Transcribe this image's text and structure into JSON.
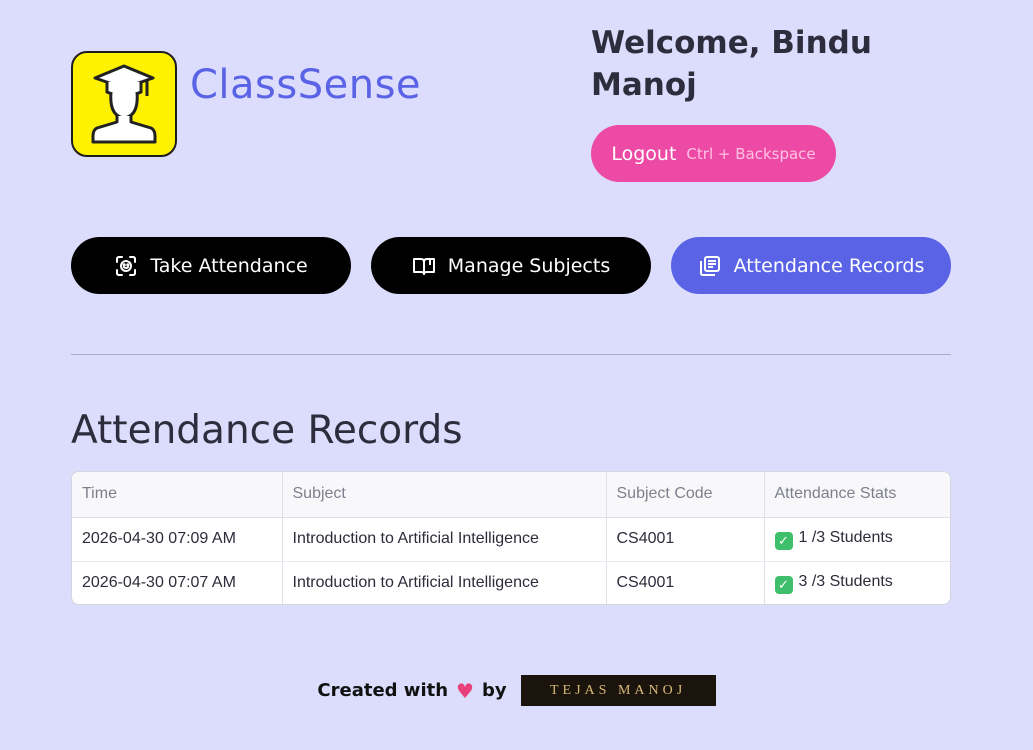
{
  "app": {
    "title": "ClassSense"
  },
  "header": {
    "welcome": "Welcome, Bindu Manoj",
    "logout_label": "Logout",
    "logout_shortcut": "Ctrl + Backspace"
  },
  "nav": {
    "take_attendance": "Take Attendance",
    "manage_subjects": "Manage Subjects",
    "attendance_records": "Attendance Records",
    "active": "attendance_records"
  },
  "records": {
    "title": "Attendance Records",
    "columns": [
      "Time",
      "Subject",
      "Subject Code",
      "Attendance Stats"
    ],
    "rows": [
      {
        "time": "2026-04-30 07:09 AM",
        "subject": "Introduction to Artificial Intelligence",
        "code": "CS4001",
        "stats": "1 /3 Students"
      },
      {
        "time": "2026-04-30 07:07 AM",
        "subject": "Introduction to Artificial Intelligence",
        "code": "CS4001",
        "stats": "3 /3 Students"
      }
    ]
  },
  "footer": {
    "created_with": "Created with",
    "by": "by",
    "signature": "TEJAS MANOJ"
  },
  "icons": {
    "logo": "graduate-icon",
    "take_attendance": "face-scan-icon",
    "manage_subjects": "book-icon",
    "attendance_records": "records-icon",
    "stats": "check-icon",
    "heart": "heart-icon"
  },
  "colors": {
    "background": "#dcdcfc",
    "accent": "#5a62e6",
    "logout": "#ec4aa5",
    "logo_bg": "#fff200"
  }
}
